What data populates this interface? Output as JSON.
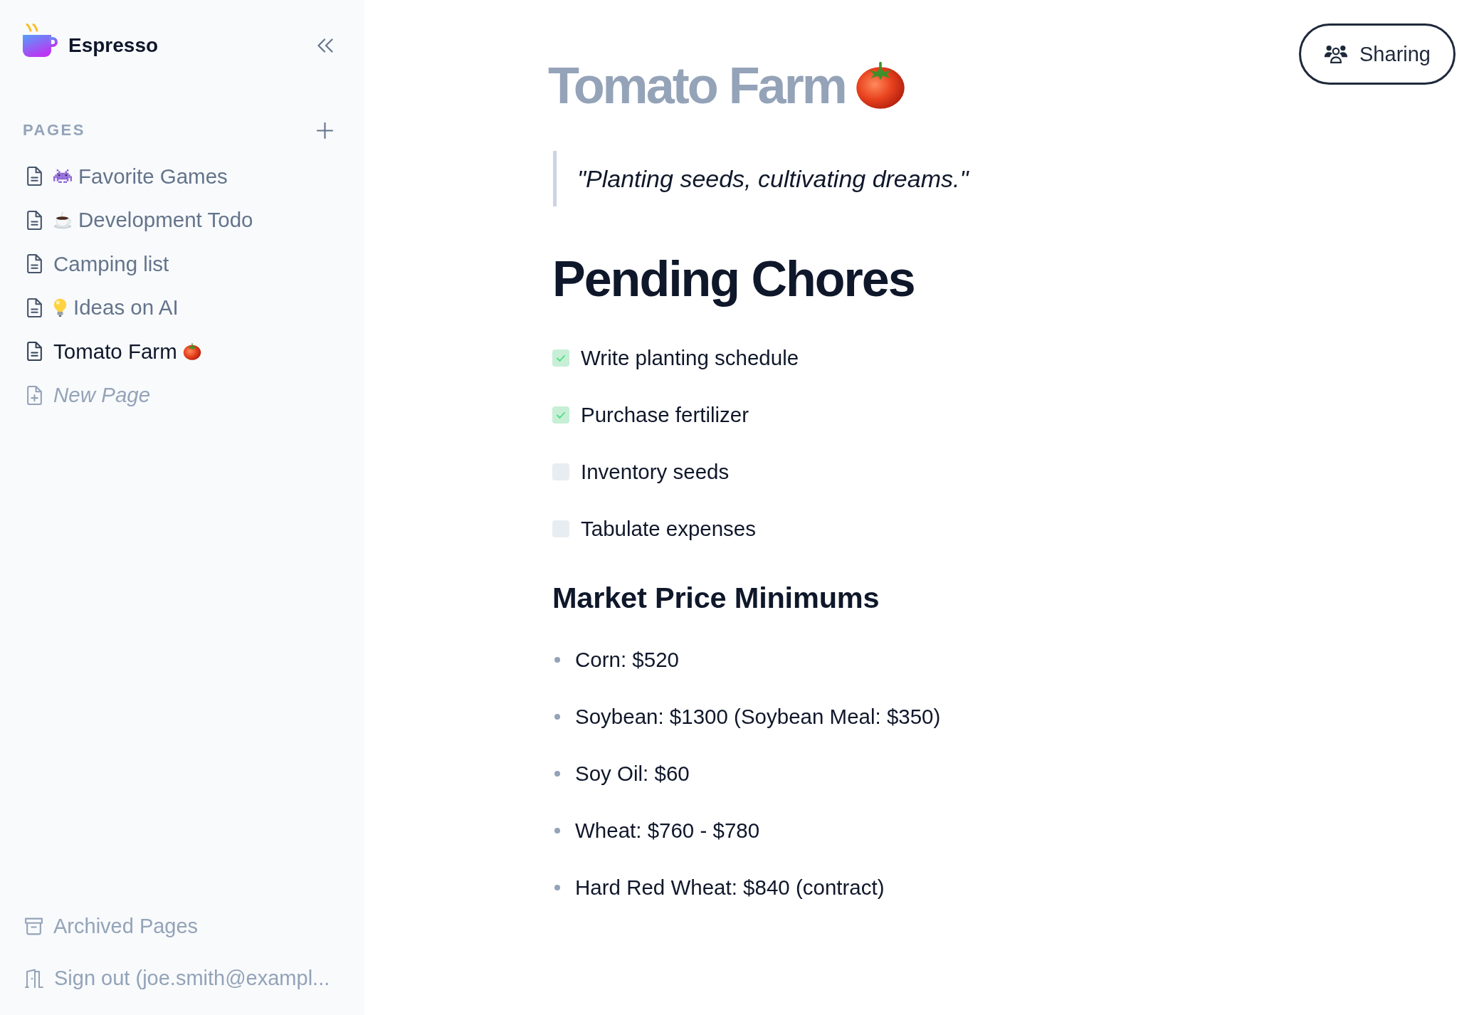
{
  "sidebar": {
    "brand": {
      "name": "Espresso"
    },
    "section": {
      "title": "PAGES"
    },
    "pages": [
      {
        "kind": "page",
        "label": "Favorite Games",
        "lead_emoji": {
          "kind": "alien"
        },
        "selected": false
      },
      {
        "kind": "page",
        "label": "Development Todo",
        "lead_emoji": {
          "kind": "coffee"
        },
        "selected": false
      },
      {
        "kind": "page",
        "label": "Camping list",
        "selected": false
      },
      {
        "kind": "page",
        "label": "Ideas on AI",
        "lead_emoji": {
          "kind": "bulb"
        },
        "selected": false
      },
      {
        "kind": "page",
        "label": "Tomato Farm",
        "trail_emoji": {
          "kind": "tomato"
        },
        "selected": true
      },
      {
        "kind": "new",
        "label": "New Page",
        "selected": false
      }
    ],
    "footer": [
      {
        "kind": "archive",
        "label": "Archived Pages"
      },
      {
        "kind": "signout",
        "label": "Sign out (joe.smith@exampl..."
      }
    ]
  },
  "sharing_button": {
    "label": "Sharing"
  },
  "document": {
    "title": "Tomato Farm",
    "title_emoji": {
      "kind": "tomato"
    },
    "quote": "\"Planting seeds, cultivating dreams.\"",
    "blocks": [
      {
        "kind": "h1",
        "text": "Pending Chores"
      },
      {
        "kind": "todo",
        "items": [
          {
            "text": "Write planting schedule",
            "checked": true
          },
          {
            "text": "Purchase fertilizer",
            "checked": true
          },
          {
            "text": "Inventory seeds",
            "checked": false
          },
          {
            "text": "Tabulate expenses",
            "checked": false
          }
        ]
      },
      {
        "kind": "h2",
        "text": "Market Price Minimums"
      },
      {
        "kind": "bullets",
        "items": [
          "Corn: $520",
          "Soybean: $1300 (Soybean Meal: $350)",
          "Soy Oil: $60",
          "Wheat: $760 - $780",
          "Hard Red Wheat: $840 (contract)"
        ]
      }
    ]
  }
}
